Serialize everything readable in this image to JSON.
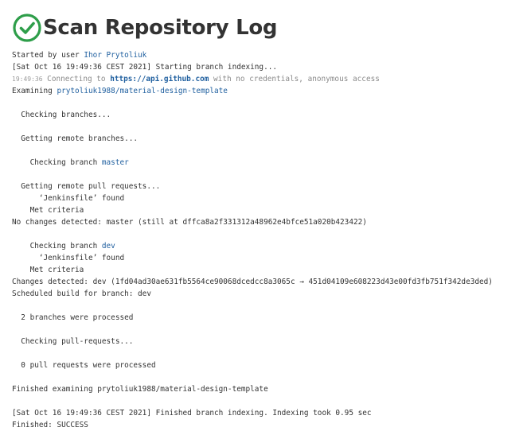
{
  "page": {
    "title": "Scan Repository Log",
    "status_icon": "check-circle-icon",
    "status_color": "#2e9e4a",
    "link_color": "#1f5f9f"
  },
  "log": {
    "started_prefix": "Started by user ",
    "started_user": "Ihor Prytoliuk",
    "start_indexing": "[Sat Oct 16 19:49:36 CEST 2021] Starting branch indexing...",
    "connect_ts": "19:49:36",
    "connect_prefix": " Connecting to ",
    "connect_url": "https://api.github.com",
    "connect_suffix": " with no credentials, anonymous access",
    "examining_prefix": "Examining ",
    "examining_repo": "prytoliuk1988/material-design-template",
    "checking_branches": "  Checking branches...",
    "getting_remote_branches": "  Getting remote branches...",
    "checking_branch_prefix": "    Checking branch ",
    "branch_master": "master",
    "getting_remote_prs": "  Getting remote pull requests...",
    "jenkinsfile_found_1": "      ‘Jenkinsfile’ found",
    "met_criteria_1": "    Met criteria",
    "no_changes": "No changes detected: master (still at dffca8a2f331312a48962e4bfce51a020b423422)",
    "checking_branch_prefix_2": "    Checking branch ",
    "branch_dev": "dev",
    "jenkinsfile_found_2": "      ‘Jenkinsfile’ found",
    "met_criteria_2": "    Met criteria",
    "changes_detected": "Changes detected: dev (1fd04ad30ae631fb5564ce90068dcedcc8a3065c → 451d04109e608223d43e00fd3fb751f342de3ded)",
    "scheduled_build": "Scheduled build for branch: dev",
    "branches_processed": "  2 branches were processed",
    "checking_prs": "  Checking pull-requests...",
    "prs_processed": "  0 pull requests were processed",
    "finished_examining": "Finished examining prytoliuk1988/material-design-template",
    "finished_indexing": "[Sat Oct 16 19:49:36 CEST 2021] Finished branch indexing. Indexing took 0.95 sec",
    "finished_status": "Finished: SUCCESS"
  }
}
